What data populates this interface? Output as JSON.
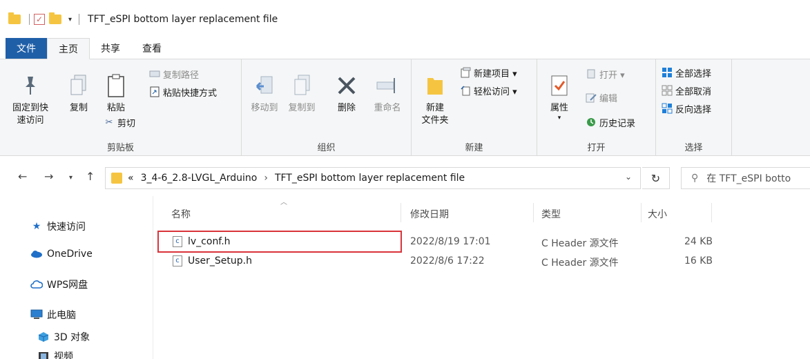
{
  "window": {
    "title": "TFT_eSPI bottom layer replacement file"
  },
  "tabs": [
    "文件",
    "主页",
    "共享",
    "查看"
  ],
  "ribbon": {
    "clipboard": {
      "pin_label_1": "固定到快",
      "pin_label_2": "速访问",
      "copy_label": "复制",
      "paste_label": "粘贴",
      "copy_path": "复制路径",
      "paste_shortcut": "粘贴快捷方式",
      "cut": "剪切",
      "group": "剪贴板"
    },
    "organize": {
      "move_to": "移动到",
      "copy_to": "复制到",
      "delete": "删除",
      "rename": "重命名",
      "group": "组织"
    },
    "new": {
      "new_folder_1": "新建",
      "new_folder_2": "文件夹",
      "new_item": "新建项目 ▾",
      "easy_access": "轻松访问 ▾",
      "group": "新建"
    },
    "open": {
      "properties": "属性",
      "open": "打开 ▾",
      "edit": "编辑",
      "history": "历史记录",
      "group": "打开"
    },
    "select": {
      "select_all": "全部选择",
      "select_none": "全部取消",
      "invert": "反向选择",
      "group": "选择"
    }
  },
  "address": {
    "prefix": "«",
    "crumbs": [
      "3_4-6_2.8-LVGL_Arduino",
      "TFT_eSPI bottom layer replacement file"
    ],
    "search_placeholder": "在 TFT_eSPI botto"
  },
  "sidebar": {
    "items": [
      {
        "label": "快速访问",
        "icon": "star-icon"
      },
      {
        "label": "OneDrive",
        "icon": "cloud-icon"
      },
      {
        "label": "WPS网盘",
        "icon": "cloud-outline-icon"
      },
      {
        "label": "此电脑",
        "icon": "computer-icon"
      },
      {
        "label": "3D 对象",
        "icon": "cube-icon"
      },
      {
        "label": "视频",
        "icon": "video-icon"
      }
    ]
  },
  "columns": {
    "name": "名称",
    "date": "修改日期",
    "type": "类型",
    "size": "大小"
  },
  "files": [
    {
      "name": "lv_conf.h",
      "date": "2022/8/19 17:01",
      "type": "C Header 源文件",
      "size": "24 KB"
    },
    {
      "name": "User_Setup.h",
      "date": "2022/8/6 17:22",
      "type": "C Header 源文件",
      "size": "16 KB"
    }
  ],
  "colors": {
    "file_tab": "#1f5fa8",
    "highlight": "#d9333a",
    "folder": "#f5c542"
  }
}
